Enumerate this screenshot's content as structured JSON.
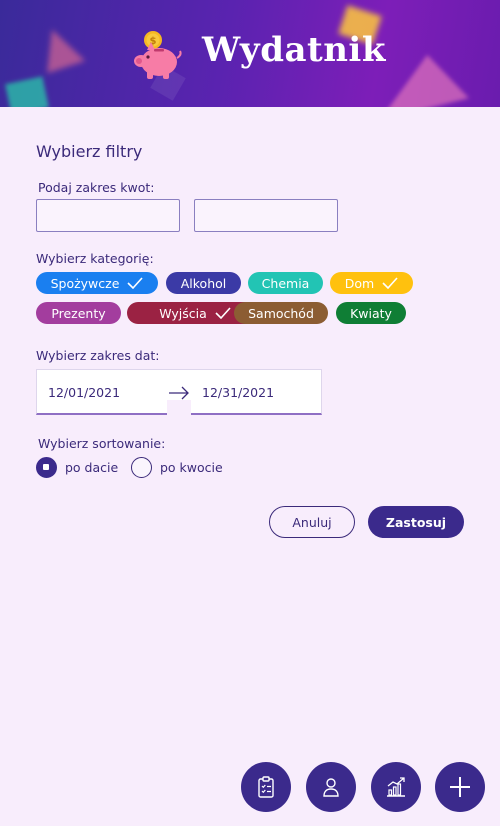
{
  "app": {
    "title": "Wydatnik"
  },
  "filters": {
    "title": "Wybierz filtry",
    "amount_label": "Podaj zakres kwot:",
    "amount_min": {
      "value": "",
      "placeholder": ""
    },
    "amount_max": {
      "value": "",
      "placeholder": ""
    },
    "category_label": "Wybierz kategorię:",
    "categories": [
      {
        "label": "Spożywcze",
        "selected": true,
        "color": "#1a7ff0"
      },
      {
        "label": "Alkohol",
        "selected": false,
        "color": "#3b3aa6"
      },
      {
        "label": "Chemia",
        "selected": false,
        "color": "#22c4b4"
      },
      {
        "label": "Dom",
        "selected": true,
        "color": "#ffc10e"
      },
      {
        "label": "Prezenty",
        "selected": false,
        "color": "#a33d9e"
      },
      {
        "label": "Wyjścia",
        "selected": true,
        "color": "#9b2243"
      },
      {
        "label": "Samochód",
        "selected": false,
        "color": "#8c5d33"
      },
      {
        "label": "Kwiaty",
        "selected": false,
        "color": "#0f7e35"
      }
    ],
    "date_label": "Wybierz zakres dat:",
    "date_from": "12/01/2021",
    "date_to": "12/31/2021",
    "sort_label": "Wybierz sortowanie:",
    "sort_options": [
      {
        "label": "po dacie",
        "checked": true
      },
      {
        "label": "po kwocie",
        "checked": false
      }
    ]
  },
  "actions": {
    "cancel": "Anuluj",
    "apply": "Zastosuj"
  },
  "bottom_nav": [
    {
      "icon": "clipboard-list-icon"
    },
    {
      "icon": "user-icon"
    },
    {
      "icon": "chart-icon"
    },
    {
      "icon": "plus-icon"
    }
  ],
  "colors": {
    "primary": "#3b2a8c",
    "background": "#f8edfc"
  }
}
